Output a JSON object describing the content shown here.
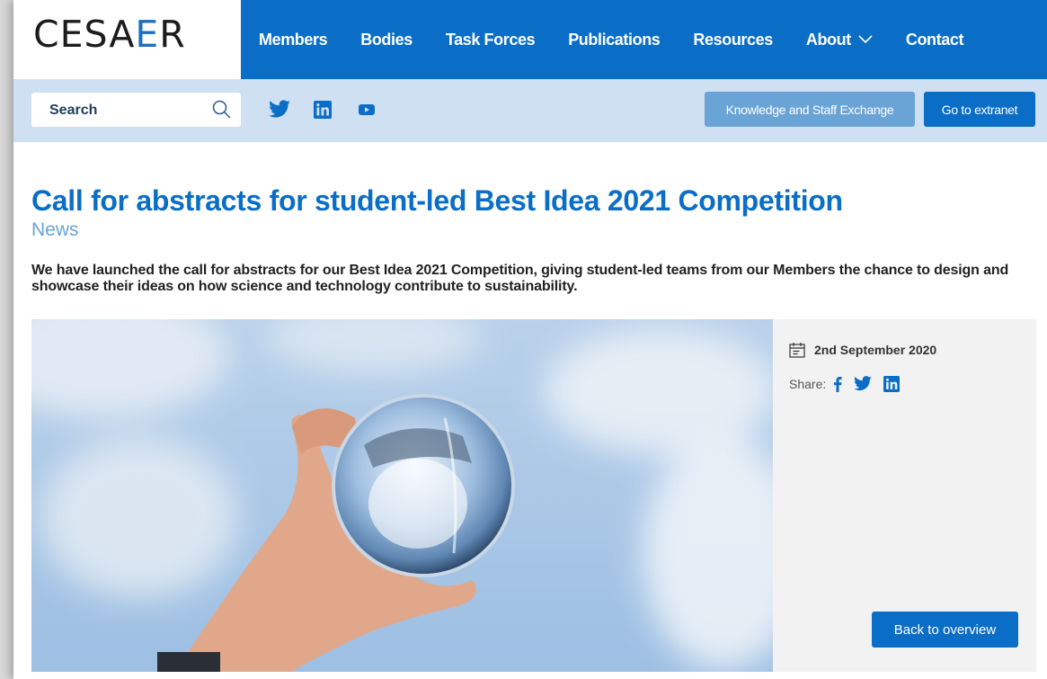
{
  "logo": {
    "text_main": "CESA",
    "text_accent": "E",
    "text_end": "R"
  },
  "nav": {
    "items": [
      {
        "label": "Members"
      },
      {
        "label": "Bodies"
      },
      {
        "label": "Task Forces"
      },
      {
        "label": "Publications"
      },
      {
        "label": "Resources"
      },
      {
        "label": "About"
      },
      {
        "label": "Contact"
      }
    ]
  },
  "subbar": {
    "search_label": "Search",
    "social": [
      "twitter-icon",
      "linkedin-icon",
      "youtube-icon"
    ],
    "kse_button": "Knowledge and Staff Exchange",
    "extranet_button": "Go to extranet"
  },
  "article": {
    "title": "Call for abstracts for student-led Best Idea 2021 Competition",
    "category": "News",
    "lead": "We have launched the call for abstracts for our Best Idea 2021 Competition, giving student-led teams from our Members the chance to design and showcase their ideas on how science and technology contribute to sustainability.",
    "date": "2nd September 2020",
    "share_label": "Share:",
    "back_button": "Back to overview"
  },
  "colors": {
    "primary": "#0a6ec6",
    "light": "#cfe0f3",
    "muted": "#6aa3d6"
  }
}
